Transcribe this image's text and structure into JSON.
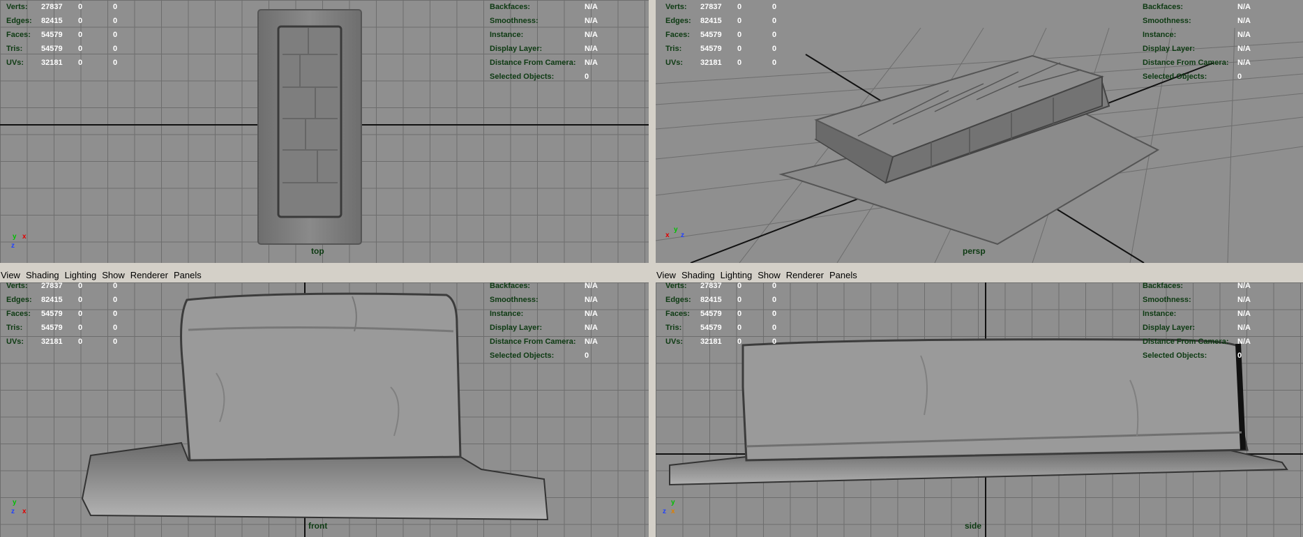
{
  "menu": [
    "View",
    "Shading",
    "Lighting",
    "Show",
    "Renderer",
    "Panels"
  ],
  "stats_left": [
    {
      "label": "Verts:",
      "v1": "27837",
      "v2": "0",
      "v3": "0"
    },
    {
      "label": "Edges:",
      "v1": "82415",
      "v2": "0",
      "v3": "0"
    },
    {
      "label": "Faces:",
      "v1": "54579",
      "v2": "0",
      "v3": "0"
    },
    {
      "label": "Tris:",
      "v1": "54579",
      "v2": "0",
      "v3": "0"
    },
    {
      "label": "UVs:",
      "v1": "32181",
      "v2": "0",
      "v3": "0"
    }
  ],
  "stats_right": [
    {
      "label": "Backfaces:",
      "value": "N/A"
    },
    {
      "label": "Smoothness:",
      "value": "N/A"
    },
    {
      "label": "Instance:",
      "value": "N/A"
    },
    {
      "label": "Display Layer:",
      "value": "N/A"
    },
    {
      "label": "Distance From Camera:",
      "value": "N/A"
    },
    {
      "label": "Selected Objects:",
      "value": "0"
    }
  ],
  "views": {
    "top": "top",
    "persp": "persp",
    "front": "front",
    "side": "side"
  },
  "axis_labels": {
    "x": "x",
    "y": "y",
    "z": "z"
  },
  "colors": {
    "viewport_bg": "#8f8f8f",
    "grid": "#6d6d6d",
    "hud_label": "#0d3a12",
    "hud_value": "#ffffff"
  }
}
